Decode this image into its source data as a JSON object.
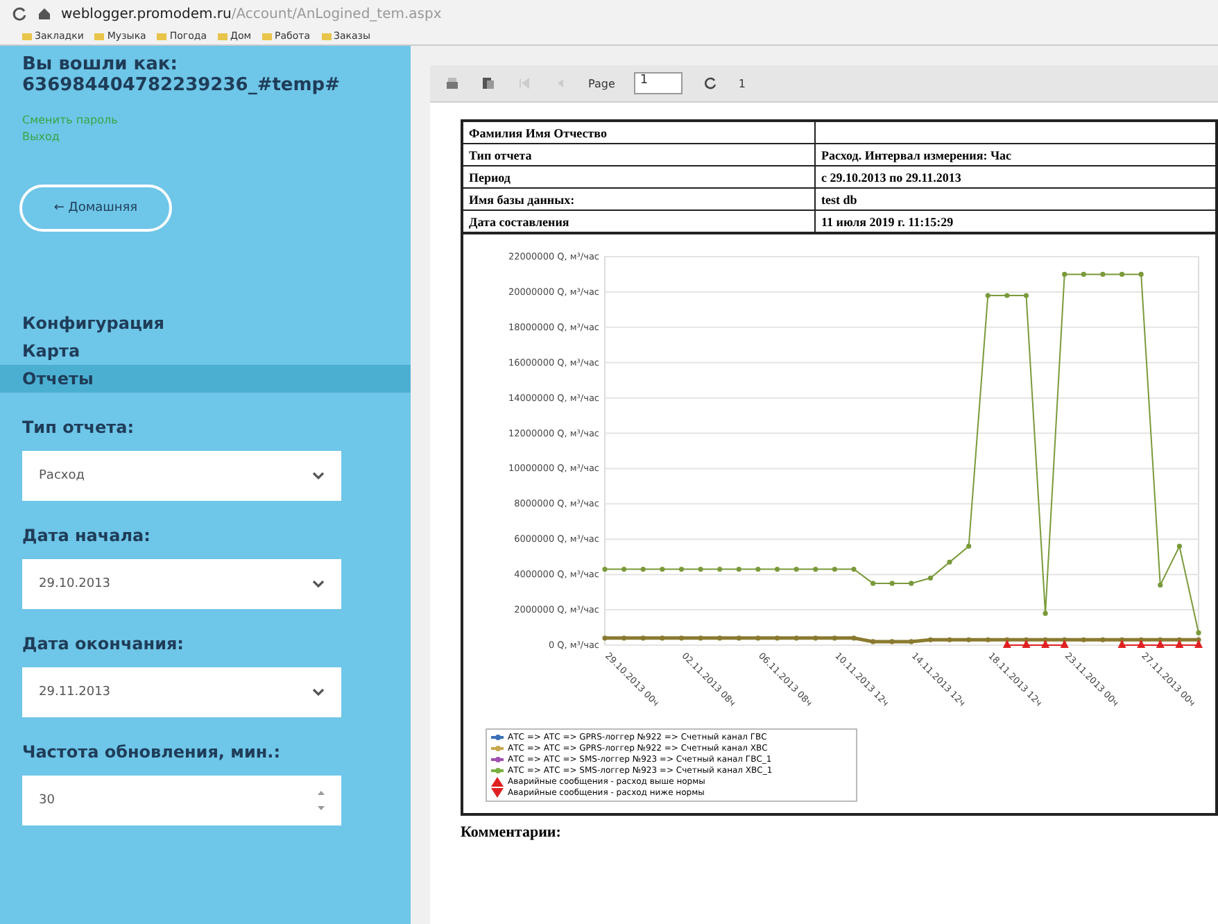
{
  "browser": {
    "url_host": "weblogger.promodem.ru",
    "url_path": "/Account/AnLogined_tem.aspx",
    "bookmarks": [
      "Закладки",
      "Музыка",
      "Погода",
      "Дом",
      "Работа",
      "Заказы"
    ]
  },
  "sidebar": {
    "login_label": "Вы вошли как:",
    "login_user": "636984404782239236_#temp#",
    "links": [
      "Сменить пароль",
      "Выход"
    ],
    "home_button": "← Домашняя",
    "nav": [
      {
        "label": "Конфигурация",
        "selected": false
      },
      {
        "label": "Карта",
        "selected": false
      },
      {
        "label": "Отчеты",
        "selected": true
      }
    ],
    "fields": [
      {
        "label": "Тип отчета:",
        "value": "Расход",
        "kind": "select"
      },
      {
        "label": "Дата начала:",
        "value": "29.10.2013",
        "kind": "select"
      },
      {
        "label": "Дата окончания:",
        "value": "29.11.2013",
        "kind": "select"
      },
      {
        "label": "Частота обновления, мин.:",
        "value": "30",
        "kind": "spinner"
      }
    ]
  },
  "report": {
    "toolbar": {
      "page_label": "Page",
      "page_value": "1",
      "page_count": "1"
    },
    "info": [
      {
        "label": "Фамилия Имя Отчество"
      },
      {
        "label": "Тип отчета",
        "value": "Расход. Интервал измерения: Час"
      },
      {
        "label": "Период",
        "value": "с 29.10.2013 по 29.11.2013"
      },
      {
        "label": "Имя базы данных:",
        "value": "test db"
      },
      {
        "label": "Дата составления",
        "value": "11 июля 2019 г. 11:15:29"
      }
    ],
    "chart_data": {
      "type": "line",
      "categories": [
        "29.10.2013 00ч",
        null,
        null,
        null,
        "02.11.2013 08ч",
        null,
        null,
        null,
        "06.11.2013 08ч",
        null,
        null,
        null,
        "10.11.2013 12ч",
        null,
        null,
        null,
        "14.11.2013 12ч",
        null,
        null,
        null,
        "18.11.2013 12ч",
        null,
        null,
        null,
        "23.11.2013 00ч",
        null,
        null,
        null,
        "27.11.2013 00ч",
        null,
        null,
        null
      ],
      "ylim": [
        0,
        22000000
      ],
      "yticks": [
        {
          "value": 0,
          "label": "0 Q, м³/час"
        },
        {
          "value": 2000000,
          "label": "2000000 Q, м³/час"
        },
        {
          "value": 4000000,
          "label": "4000000 Q, м³/час"
        },
        {
          "value": 6000000,
          "label": "6000000 Q, м³/час"
        },
        {
          "value": 8000000,
          "label": "8000000 Q, м³/час"
        },
        {
          "value": 10000000,
          "label": "10000000 Q, м³/час"
        },
        {
          "value": 12000000,
          "label": "12000000 Q, м³/час"
        },
        {
          "value": 14000000,
          "label": "14000000 Q, м³/час"
        },
        {
          "value": 16000000,
          "label": "16000000 Q, м³/час"
        },
        {
          "value": 18000000,
          "label": "18000000 Q, м³/час"
        },
        {
          "value": 20000000,
          "label": "20000000 Q, м³/час"
        },
        {
          "value": 22000000,
          "label": "22000000 Q, м³/час"
        }
      ],
      "series": [
        {
          "color": "#7a9a3a",
          "marker": "circle",
          "values": [
            4300000,
            4300000,
            4300000,
            4300000,
            4300000,
            4300000,
            4300000,
            4300000,
            4300000,
            4300000,
            4300000,
            4300000,
            4300000,
            4300000,
            3500000,
            3500000,
            3500000,
            3800000,
            4700000,
            5600000,
            19800000,
            19800000,
            19800000,
            1800000,
            21000000,
            21000000,
            21000000,
            21000000,
            21000000,
            3400000,
            5600000,
            700000
          ]
        },
        {
          "color": "#8a7a30",
          "marker": "circle",
          "values": [
            400000,
            400000,
            400000,
            400000,
            400000,
            400000,
            400000,
            400000,
            400000,
            400000,
            400000,
            400000,
            400000,
            400000,
            200000,
            200000,
            200000,
            300000,
            300000,
            300000,
            300000,
            300000,
            300000,
            300000,
            300000,
            300000,
            300000,
            300000,
            300000,
            300000,
            300000,
            300000
          ]
        },
        {
          "color": "#e02020",
          "marker": "triangle",
          "values": [
            null,
            null,
            null,
            null,
            null,
            null,
            null,
            null,
            null,
            null,
            null,
            null,
            null,
            null,
            null,
            null,
            null,
            null,
            null,
            null,
            null,
            0,
            0,
            0,
            0,
            null,
            null,
            0,
            0,
            0,
            0,
            0
          ]
        }
      ],
      "grid": true
    },
    "legend": [
      {
        "label": "АТС => АТС => GPRS-логгер №922 => Счетный канал ГВС",
        "color": "#3a70b8",
        "kind": "line"
      },
      {
        "label": "АТС => АТС => GPRS-логгер №922 => Счетный канал ХВС",
        "color": "#c8a850",
        "kind": "line"
      },
      {
        "label": "АТС => АТС => SMS-логгер №923 => Счетный канал ГВС_1",
        "color": "#a050b0",
        "kind": "line"
      },
      {
        "label": "АТС => АТС => SMS-логгер №923 => Счетный канал ХВС_1",
        "color": "#7ab040",
        "kind": "line"
      },
      {
        "label": "Аварийные сообщения - расход выше нормы",
        "color": "#e02020",
        "kind": "up"
      },
      {
        "label": "Аварийные сообщения - расход ниже нормы",
        "color": "#e02020",
        "kind": "down"
      }
    ],
    "comments_label": "Комментарии:"
  }
}
